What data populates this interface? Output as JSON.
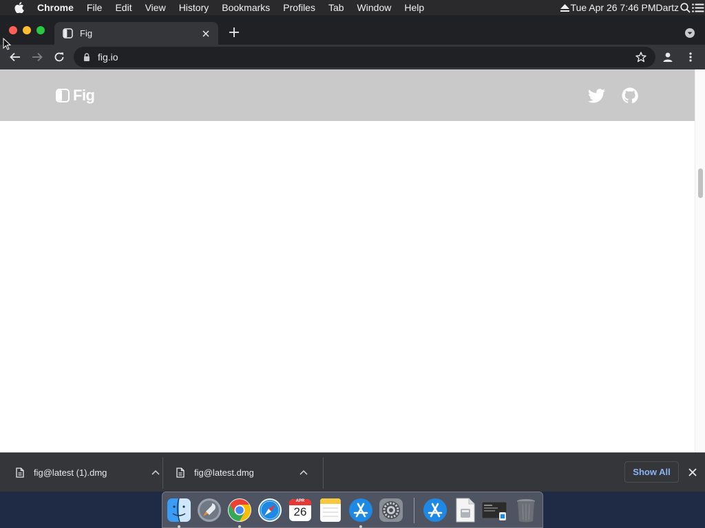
{
  "menubar": {
    "apple_icon": "apple-icon",
    "items": [
      "Chrome",
      "File",
      "Edit",
      "View",
      "History",
      "Bookmarks",
      "Profiles",
      "Tab",
      "Window",
      "Help"
    ],
    "clock": "Tue Apr 26  7:46 PM",
    "user": "Dartz"
  },
  "browser": {
    "tab_title": "Fig",
    "url": "fig.io"
  },
  "site": {
    "logo_text": "Fig",
    "header_color": "#c9c9c9"
  },
  "downloads": {
    "items": [
      {
        "name": "fig@latest (1).dmg"
      },
      {
        "name": "fig@latest.dmg"
      }
    ],
    "show_all": "Show All"
  },
  "dock": {
    "apps": [
      "finder",
      "launchpad",
      "chrome",
      "safari",
      "calendar",
      "notes",
      "app-store",
      "system-preferences",
      "app-store-downloads",
      "installer-document",
      "terminal-screenshot",
      "trash"
    ],
    "calendar": {
      "month": "APR",
      "day": "26"
    }
  }
}
